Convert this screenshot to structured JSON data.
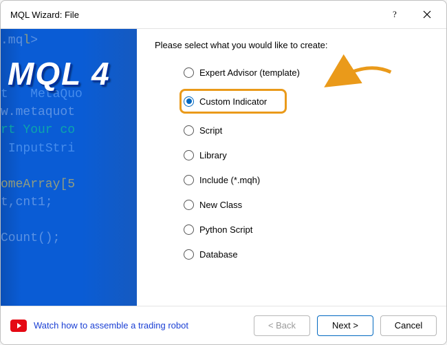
{
  "window": {
    "title": "MQL Wizard: File"
  },
  "sidebar": {
    "logo": "MQL 4"
  },
  "main": {
    "prompt": "Please select what you would like to create:",
    "options": [
      {
        "label": "Expert Advisor (template)",
        "selected": false
      },
      {
        "label": "Custom Indicator",
        "selected": true
      },
      {
        "label": "Script",
        "selected": false
      },
      {
        "label": "Library",
        "selected": false
      },
      {
        "label": "Include (*.mqh)",
        "selected": false
      },
      {
        "label": "New Class",
        "selected": false
      },
      {
        "label": "Python Script",
        "selected": false
      },
      {
        "label": "Database",
        "selected": false
      }
    ]
  },
  "footer": {
    "link": "Watch how to assemble a trading robot",
    "back": "< Back",
    "next": "Next >",
    "cancel": "Cancel"
  }
}
